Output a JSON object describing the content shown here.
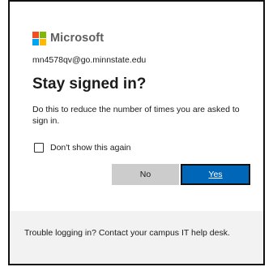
{
  "brand": {
    "name": "Microsoft",
    "logo_icon": "microsoft-four-squares-logo",
    "colors": [
      "#f25022",
      "#7fba00",
      "#00a4ef",
      "#ffb900"
    ]
  },
  "identity": {
    "email": "mn4578qv@go.minnstate.edu"
  },
  "dialog": {
    "title": "Stay signed in?",
    "description": "Do this to reduce the number of times you are asked to sign in."
  },
  "checkbox": {
    "label": "Don't show this again",
    "checked": false
  },
  "buttons": {
    "no_label": "No",
    "yes_label": "Yes",
    "primary_color": "#0067b8"
  },
  "footer": {
    "text": "Trouble logging in? Contact your campus IT help desk."
  }
}
